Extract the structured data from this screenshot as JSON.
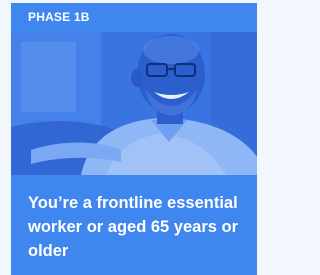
{
  "card": {
    "phase_label": "PHASE 1B",
    "image_alt": "Smiling older man",
    "description": "You’re a frontline essential worker or aged 65 years or older"
  },
  "colors": {
    "card_blue": "#3f86ee",
    "photo_tint": "#3b77e4",
    "text": "#ffffff",
    "page_bg": "#f2f6fd"
  }
}
